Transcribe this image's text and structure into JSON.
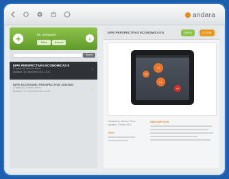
{
  "toolbar": {
    "icons": [
      "back-icon",
      "refresh-icon",
      "settings-icon",
      "share-icon",
      "help-icon"
    ],
    "brand_name": "andara"
  },
  "user": {
    "name": "Mr. Santander",
    "segments": [
      "Files",
      "Recent"
    ]
  },
  "search": {
    "placeholder": "",
    "button_label": "Search"
  },
  "list": [
    {
      "title": "EIPE PERSPECTIVAS ECONOMICAS E",
      "created_by": "Created by: Antonio Pérez",
      "updated": "Updated: 15 December 2011 13:11",
      "active": true
    },
    {
      "title": "EIPE ECONOMIC PERSPECTIVE 2011/EM",
      "created_by": "Created by: Antonio Pérez",
      "updated": "Updated: 15 December 2011 13:11",
      "active": false
    }
  ],
  "detail": {
    "title": "EIPE PERSPECTIVAS ECONOMICAS E",
    "open_label": "OPEN",
    "close_label": "CLOSE",
    "created_label": "Created by: Antonio Pérez",
    "updated_label": "Updated: 15 Dec 2011",
    "file_label": "TEXT",
    "description_heading": "DESCRIPTION"
  },
  "bubbles": [
    {
      "label": "0.3",
      "color": "#e8762c"
    },
    {
      "label": "1.5",
      "color": "#e8762c"
    },
    {
      "label": "2.1",
      "color": "#e8762c"
    },
    {
      "label": "0.8",
      "color": "#d8352a"
    }
  ],
  "colors": {
    "accent_green": "#8fc34a",
    "accent_orange": "#e59a1f",
    "frame_blue": "#1d5fae"
  }
}
